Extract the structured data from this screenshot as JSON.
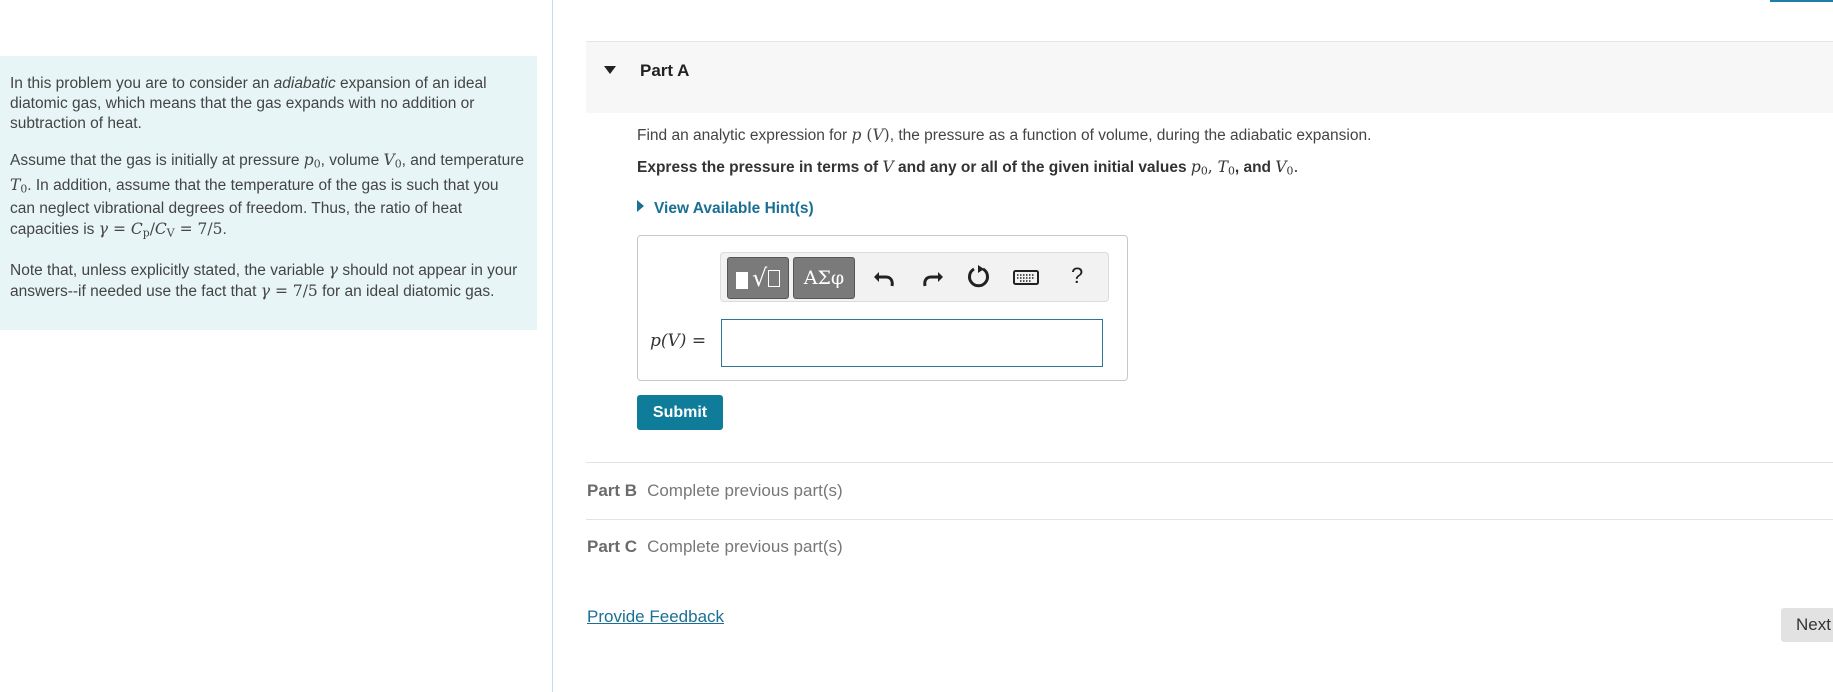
{
  "intro": {
    "p1_pre": "In this problem you are to consider an ",
    "p1_em": "adiabatic",
    "p1_post": " expansion of an ideal diatomic gas, which means that the gas expands with no addition or subtraction of heat.",
    "p2_a": "Assume that the gas is initially at pressure ",
    "p2_b": ", volume ",
    "p2_c": ", and temperature ",
    "p2_d": ". In addition, assume that the temperature of the gas is such that you can neglect vibrational degrees of freedom. Thus, the ratio of heat capacities is ",
    "p2_e": ".",
    "p3_a": "Note that, unless explicitly stated, the variable ",
    "p3_b": " should not appear in your answers--if needed use the fact that ",
    "p3_c": " for an ideal diatomic gas."
  },
  "partA": {
    "title": "Part A",
    "question_pre": "Find an analytic expression for ",
    "question_post": ", the pressure as a function of volume, during the adiabatic expansion.",
    "instruction_a": "Express the pressure in terms of ",
    "instruction_b": " and any or all of the given initial values ",
    "instruction_c": ", and ",
    "hints_label": "View Available Hint(s)",
    "symbols_label": "ΑΣφ",
    "help_label": "?",
    "answer_label": "p(V) =",
    "answer_value": "",
    "submit_label": "Submit"
  },
  "partB": {
    "label": "Part B",
    "status": "Complete previous part(s)"
  },
  "partC": {
    "label": "Part C",
    "status": "Complete previous part(s)"
  },
  "footer": {
    "feedback_label": "Provide Feedback",
    "next_label": "Next"
  },
  "icons": {
    "toolbar": [
      "templates-icon",
      "greek-symbols-icon",
      "undo-icon",
      "redo-icon",
      "reset-icon",
      "keyboard-icon",
      "help-icon"
    ],
    "hints": "caret-right-icon",
    "part_a": "caret-down-icon"
  },
  "colors": {
    "accent": "#0f7c99",
    "link": "#1a6f94",
    "intro_bg": "#e7f5f7"
  }
}
